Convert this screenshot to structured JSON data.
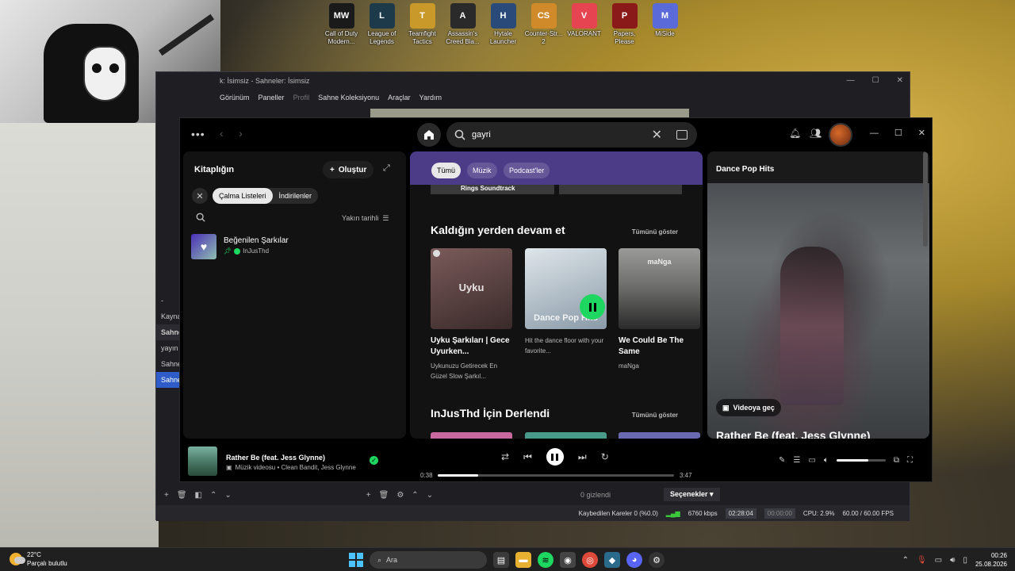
{
  "desktop": {
    "icons": [
      {
        "label": "Call of Duty Modern...",
        "color": "#1a1a1a",
        "glyph": "MW"
      },
      {
        "label": "League of Legends",
        "color": "#1c3a4a",
        "glyph": "L"
      },
      {
        "label": "Teamfight Tactics",
        "color": "#c99a2a",
        "glyph": "T"
      },
      {
        "label": "Assassin's Creed Bla...",
        "color": "#2a2a2a",
        "glyph": "A"
      },
      {
        "label": "Hytale Launcher",
        "color": "#2a4a7a",
        "glyph": "H"
      },
      {
        "label": "Counter-Str... 2",
        "color": "#d08a2a",
        "glyph": "CS"
      },
      {
        "label": "VALORANT",
        "color": "#e64450",
        "glyph": "V"
      },
      {
        "label": "Papers, Please",
        "color": "#8a1a1a",
        "glyph": "P"
      },
      {
        "label": "MiSide",
        "color": "#5a6ad8",
        "glyph": "M"
      }
    ]
  },
  "obs": {
    "title": "k: İsimsiz - Sahneler: İsimsiz",
    "menu": [
      "Görünüm",
      "Paneller",
      "Profil",
      "Sahne Koleksiyonu",
      "Araçlar",
      "Yardım"
    ],
    "side": [
      "-",
      "Kayna",
      "Sahne",
      "yayın",
      "Sahne",
      "Sahne"
    ],
    "hidden_count": "0 gizlendi",
    "options": "Seçenekler",
    "status": {
      "dropped": "Kaybedilen Kareler 0 (%0.0)",
      "bitrate": "6760 kbps",
      "stream_time": "02:28:04",
      "rec_time": "00:00:00",
      "cpu": "CPU: 2.9%",
      "fps": "60.00 / 60.00 FPS"
    }
  },
  "spotify": {
    "search_value": "gayri",
    "library": {
      "title": "Kitaplığın",
      "create": "Oluştur",
      "chips": [
        "Çalma Listeleri",
        "İndirilenler"
      ],
      "sort": "Yakın tarihli",
      "items": [
        {
          "title": "Beğenilen Şarkılar",
          "owner": "InJusThd"
        }
      ]
    },
    "main": {
      "chips": [
        "Tümü",
        "Müzik",
        "Podcast'ler"
      ],
      "prev_row": "Rings Soundtrack",
      "section1": {
        "title": "Kaldığın yerden devam et",
        "show_all": "Tümünü göster"
      },
      "cards": [
        {
          "art_label": "Uyku",
          "title": "Uyku Şarkıları | Gece Uyurken...",
          "subtitle": "Uykunuzu Getirecek En Güzel Slow Şarkıl...",
          "c1": "#6a4a4a",
          "c2": "#3a2a2a"
        },
        {
          "art_label": "Dance Pop Hits",
          "title": "Dance Pop Hits",
          "subtitle": "Hit the dance floor with your favorite...",
          "c1": "#c8d4dc",
          "c2": "#8a9aa8"
        },
        {
          "art_label": "maNga",
          "title": "We Could Be The Same",
          "subtitle": "maNga",
          "c1": "#8a8a88",
          "c2": "#2a2a2a"
        }
      ],
      "section2": {
        "title": "InJusThd İçin Derlendi",
        "show_all": "Tümünü göster"
      }
    },
    "now_playing": {
      "title": "Dance Pop Hits",
      "video_button": "Videoya geç",
      "song": "Rather Be (feat. Jess Glynne)"
    },
    "player": {
      "title": "Rather Be (feat. Jess Glynne)",
      "subtitle": "Müzik videosu • Clean Bandit, Jess Glynne",
      "elapsed": "0:38",
      "duration": "3:47",
      "progress": 0.17,
      "volume": 0.65
    }
  },
  "taskbar": {
    "temp": "22°C",
    "weather": "Parçalı bulutlu",
    "search": "Ara",
    "time": "00:26",
    "date": "25.08.2026"
  }
}
